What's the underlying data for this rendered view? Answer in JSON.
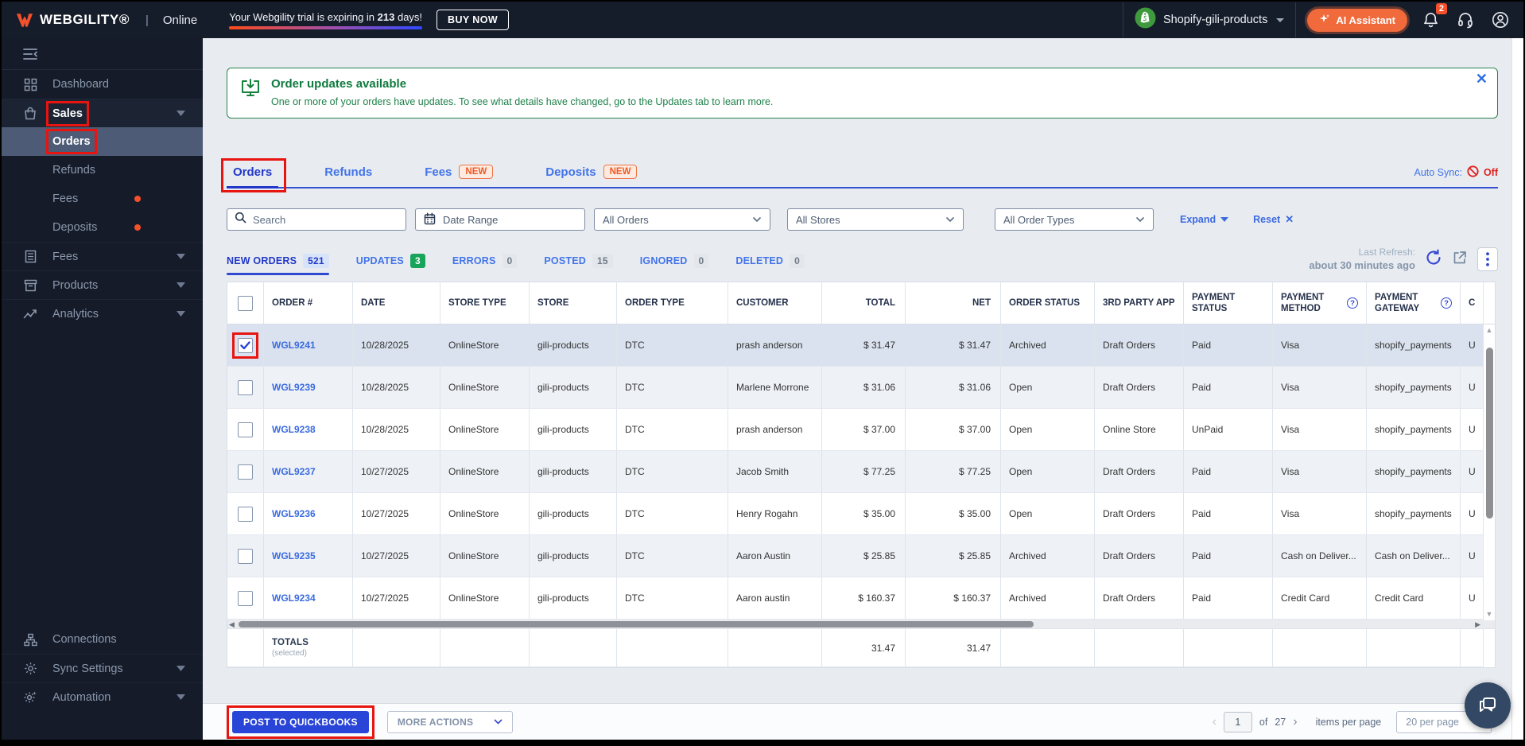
{
  "topbar": {
    "brand": "WEBGILITY®",
    "separator": "|",
    "mode": "Online",
    "trial_prefix": "Your Webgility trial is expiring in ",
    "trial_days": "213",
    "trial_suffix": " days!",
    "buy_now_label": "BUY NOW",
    "store_name": "Shopify-gili-products",
    "ai_assistant_label": "AI Assistant",
    "notification_count": "2"
  },
  "sidebar": {
    "items": [
      {
        "label": "Dashboard",
        "icon": "dashboard-icon",
        "type": "top"
      },
      {
        "label": "Sales",
        "icon": "sales-icon",
        "type": "top",
        "expanded": true,
        "annotated": true,
        "chevron": true
      },
      {
        "label": "Orders",
        "type": "sub",
        "active": true,
        "annotated": true
      },
      {
        "label": "Refunds",
        "type": "sub"
      },
      {
        "label": "Fees",
        "type": "sub",
        "dot": true
      },
      {
        "label": "Deposits",
        "type": "sub",
        "dot": true
      },
      {
        "label": "Fees",
        "icon": "fees-icon",
        "type": "top",
        "chevron": true
      },
      {
        "label": "Products",
        "icon": "products-icon",
        "type": "top",
        "chevron": true
      },
      {
        "label": "Analytics",
        "icon": "analytics-icon",
        "type": "top",
        "chevron": true
      }
    ],
    "bottom_items": [
      {
        "label": "Connections",
        "icon": "connections-icon"
      },
      {
        "label": "Sync Settings",
        "icon": "sync-settings-icon",
        "chevron": true
      },
      {
        "label": "Automation",
        "icon": "automation-icon",
        "chevron": true
      }
    ]
  },
  "banner": {
    "title": "Order updates available",
    "message": "One or more of your orders have updates. To see what details have changed, go to the Updates tab to learn more."
  },
  "tabs": [
    {
      "label": "Orders",
      "active": true,
      "annotated": true
    },
    {
      "label": "Refunds"
    },
    {
      "label": "Fees",
      "badge": "NEW"
    },
    {
      "label": "Deposits",
      "badge": "NEW"
    }
  ],
  "auto_sync": {
    "label": "Auto Sync:",
    "status": "Off"
  },
  "filters": {
    "search_placeholder": "Search",
    "date_range_label": "Date Range",
    "orders_dropdown": "All Orders",
    "stores_dropdown": "All Stores",
    "order_types_dropdown": "All Order Types",
    "expand_label": "Expand",
    "reset_label": "Reset"
  },
  "status_tabs": [
    {
      "label": "NEW ORDERS",
      "count": "521",
      "variant": "blue",
      "active": true
    },
    {
      "label": "UPDATES",
      "count": "3",
      "variant": "green"
    },
    {
      "label": "ERRORS",
      "count": "0",
      "variant": "gray"
    },
    {
      "label": "POSTED",
      "count": "15",
      "variant": "gray"
    },
    {
      "label": "IGNORED",
      "count": "0",
      "variant": "gray"
    },
    {
      "label": "DELETED",
      "count": "0",
      "variant": "gray"
    }
  ],
  "refresh": {
    "label": "Last Refresh:",
    "value": "about 30 minutes ago"
  },
  "table": {
    "columns": [
      {
        "key": "check",
        "label": ""
      },
      {
        "key": "order",
        "label": "ORDER #"
      },
      {
        "key": "date",
        "label": "DATE"
      },
      {
        "key": "store_type",
        "label": "STORE TYPE"
      },
      {
        "key": "store",
        "label": "STORE"
      },
      {
        "key": "order_type",
        "label": "ORDER TYPE"
      },
      {
        "key": "customer",
        "label": "CUSTOMER"
      },
      {
        "key": "total",
        "label": "TOTAL",
        "align": "right"
      },
      {
        "key": "net",
        "label": "NET",
        "align": "right"
      },
      {
        "key": "status",
        "label": "ORDER STATUS"
      },
      {
        "key": "app",
        "label": "3RD PARTY APP"
      },
      {
        "key": "pay_status",
        "label": "PAYMENT STATUS"
      },
      {
        "key": "pay_method",
        "label": "PAYMENT METHOD",
        "info": true
      },
      {
        "key": "gateway",
        "label": "PAYMENT GATEWAY",
        "info": true
      },
      {
        "key": "extra",
        "label": "C"
      }
    ],
    "rows": [
      {
        "checked": true,
        "annotated": true,
        "order": "WGL9241",
        "date": "10/28/2025",
        "store_type": "OnlineStore",
        "store": "gili-products",
        "order_type": "DTC",
        "customer": "prash anderson",
        "total": "$ 31.47",
        "net": "$ 31.47",
        "status": "Archived",
        "app": "Draft Orders",
        "pay_status": "Paid",
        "pay_method": "Visa",
        "gateway": "shopify_payments",
        "extra": "U"
      },
      {
        "order": "WGL9239",
        "date": "10/28/2025",
        "store_type": "OnlineStore",
        "store": "gili-products",
        "order_type": "DTC",
        "customer": "Marlene Morrone",
        "total": "$ 31.06",
        "net": "$ 31.06",
        "status": "Open",
        "app": "Draft Orders",
        "pay_status": "Paid",
        "pay_method": "Visa",
        "gateway": "shopify_payments",
        "extra": "U"
      },
      {
        "order": "WGL9238",
        "date": "10/28/2025",
        "store_type": "OnlineStore",
        "store": "gili-products",
        "order_type": "DTC",
        "customer": "prash anderson",
        "total": "$ 37.00",
        "net": "$ 37.00",
        "status": "Open",
        "app": "Online Store",
        "pay_status": "UnPaid",
        "pay_method": "Visa",
        "gateway": "shopify_payments",
        "extra": "U"
      },
      {
        "order": "WGL9237",
        "date": "10/27/2025",
        "store_type": "OnlineStore",
        "store": "gili-products",
        "order_type": "DTC",
        "customer": "Jacob Smith",
        "total": "$ 77.25",
        "net": "$ 77.25",
        "status": "Open",
        "app": "Draft Orders",
        "pay_status": "Paid",
        "pay_method": "Visa",
        "gateway": "shopify_payments",
        "extra": "U"
      },
      {
        "order": "WGL9236",
        "date": "10/27/2025",
        "store_type": "OnlineStore",
        "store": "gili-products",
        "order_type": "DTC",
        "customer": "Henry Rogahn",
        "total": "$ 35.00",
        "net": "$ 35.00",
        "status": "Open",
        "app": "Draft Orders",
        "pay_status": "Paid",
        "pay_method": "Visa",
        "gateway": "shopify_payments",
        "extra": "U"
      },
      {
        "order": "WGL9235",
        "date": "10/27/2025",
        "store_type": "OnlineStore",
        "store": "gili-products",
        "order_type": "DTC",
        "customer": "Aaron Austin",
        "total": "$ 25.85",
        "net": "$ 25.85",
        "status": "Archived",
        "app": "Draft Orders",
        "pay_status": "Paid",
        "pay_method": "Cash on Deliver...",
        "gateway": "Cash on Deliver...",
        "extra": "U"
      },
      {
        "order": "WGL9234",
        "date": "10/27/2025",
        "store_type": "OnlineStore",
        "store": "gili-products",
        "order_type": "DTC",
        "customer": "Aaron austin",
        "total": "$ 160.37",
        "net": "$ 160.37",
        "status": "Archived",
        "app": "Draft Orders",
        "pay_status": "Paid",
        "pay_method": "Credit Card",
        "gateway": "Credit Card",
        "extra": "U"
      }
    ],
    "totals": {
      "label": "TOTALS",
      "sublabel": "(selected)",
      "total": "31.47",
      "net": "31.47"
    }
  },
  "footer": {
    "post_button": "POST TO QUICKBOOKS",
    "more_actions": "MORE ACTIONS",
    "page_input": "1",
    "of_label": "of",
    "total_pages": "27",
    "items_per_page_label": "items per page",
    "per_page_value": "20 per page"
  }
}
